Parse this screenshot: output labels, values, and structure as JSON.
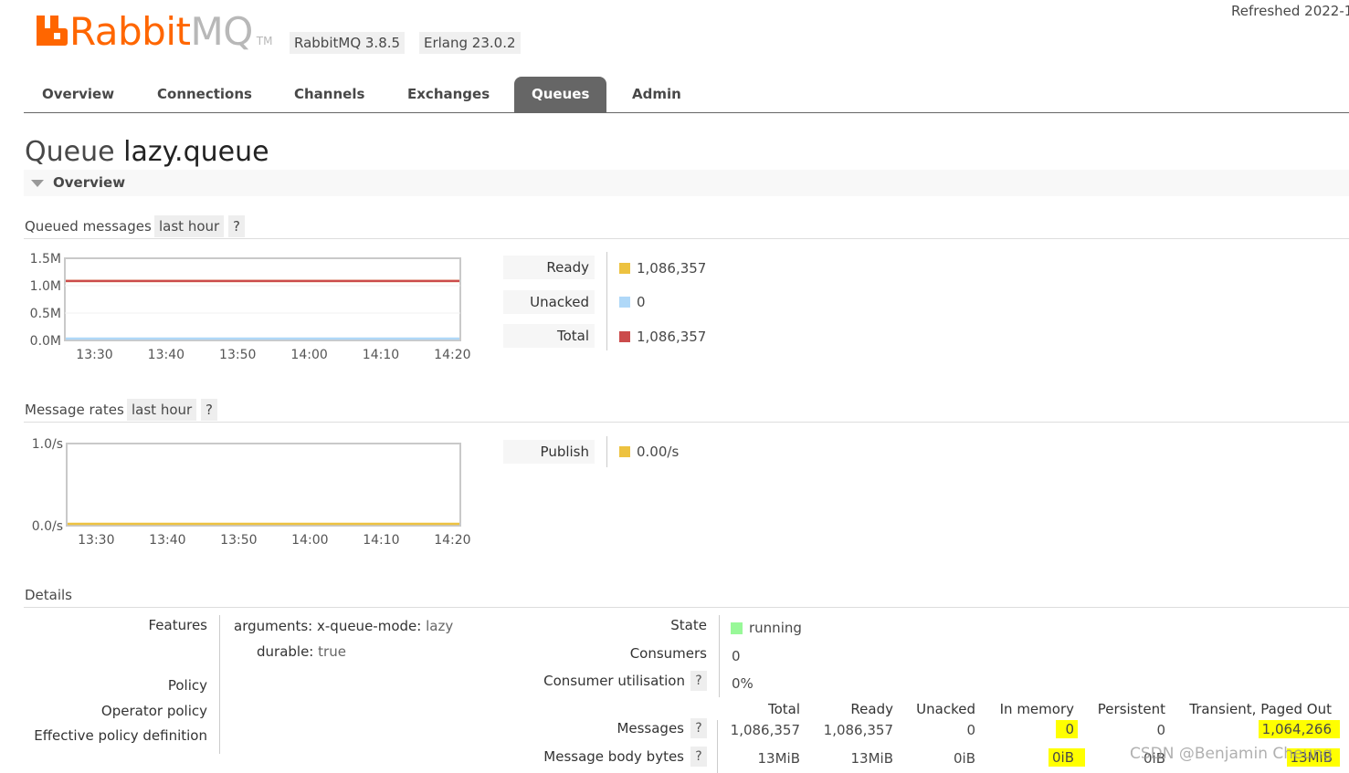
{
  "header": {
    "logo_text_rabbit": "Rabbit",
    "logo_text_mq": "MQ",
    "logo_tm": "TM",
    "rabbitmq_version": "RabbitMQ 3.8.5",
    "erlang_version": "Erlang 23.0.2",
    "refreshed": "Refreshed 2022-1"
  },
  "tabs": [
    {
      "label": "Overview",
      "active": false
    },
    {
      "label": "Connections",
      "active": false
    },
    {
      "label": "Channels",
      "active": false
    },
    {
      "label": "Exchanges",
      "active": false
    },
    {
      "label": "Queues",
      "active": true
    },
    {
      "label": "Admin",
      "active": false
    }
  ],
  "page": {
    "title_prefix": "Queue",
    "queue_name": "lazy.queue",
    "section": "Overview"
  },
  "queued_messages": {
    "heading": "Queued messages",
    "range": "last hour",
    "help": "?",
    "legend": [
      {
        "label": "Ready",
        "value": "1,086,357",
        "color": "#edc240"
      },
      {
        "label": "Unacked",
        "value": "0",
        "color": "#afd8f8"
      },
      {
        "label": "Total",
        "value": "1,086,357",
        "color": "#cb4b4b"
      }
    ]
  },
  "message_rates": {
    "heading": "Message rates",
    "range": "last hour",
    "help": "?",
    "legend": [
      {
        "label": "Publish",
        "value": "0.00/s",
        "color": "#edc240"
      }
    ]
  },
  "chart_data": [
    {
      "type": "line",
      "title": "Queued messages",
      "x": [
        "13:30",
        "13:40",
        "13:50",
        "14:00",
        "14:10",
        "14:20"
      ],
      "y_ticks": [
        "1.5M",
        "1.0M",
        "0.5M",
        "0.0M"
      ],
      "ylim": [
        0,
        1500000
      ],
      "series": [
        {
          "name": "Total",
          "color": "#cb4b4b",
          "values": [
            1086357,
            1086357,
            1086357,
            1086357,
            1086357,
            1086357
          ]
        },
        {
          "name": "Ready",
          "color": "#edc240",
          "values": [
            1086357,
            1086357,
            1086357,
            1086357,
            1086357,
            1086357
          ]
        },
        {
          "name": "Unacked",
          "color": "#afd8f8",
          "values": [
            0,
            0,
            0,
            0,
            0,
            0
          ]
        }
      ]
    },
    {
      "type": "line",
      "title": "Message rates",
      "x": [
        "13:30",
        "13:40",
        "13:50",
        "14:00",
        "14:10",
        "14:20"
      ],
      "y_ticks": [
        "1.0/s",
        "0.0/s"
      ],
      "ylim": [
        0,
        1
      ],
      "series": [
        {
          "name": "Publish",
          "color": "#edc240",
          "values": [
            0,
            0,
            0,
            0,
            0,
            0
          ]
        }
      ]
    }
  ],
  "details": {
    "heading": "Details",
    "features_label": "Features",
    "arguments_key": "arguments:",
    "arguments_name": "x-queue-mode:",
    "arguments_value": "lazy",
    "durable_key": "durable:",
    "durable_value": "true",
    "policy_label": "Policy",
    "operator_policy_label": "Operator policy",
    "effective_policy_label": "Effective policy definition",
    "state_label": "State",
    "state_value": "running",
    "state_color": "#98f898",
    "consumers_label": "Consumers",
    "consumers_value": "0",
    "consumer_util_label": "Consumer utilisation",
    "consumer_util_value": "0%",
    "help": "?",
    "table": {
      "columns": [
        "Total",
        "Ready",
        "Unacked",
        "In memory",
        "Persistent",
        "Transient, Paged Out"
      ],
      "rows": [
        {
          "label": "Messages",
          "values": [
            "1,086,357",
            "1,086,357",
            "0",
            "0",
            "0",
            "1,064,266"
          ]
        },
        {
          "label": "Message body bytes",
          "values": [
            "13MiB",
            "13MiB",
            "0iB",
            "0iB",
            "0iB",
            "13MiB"
          ]
        }
      ]
    }
  },
  "watermark": "CSDN @Benjamin Cheung"
}
